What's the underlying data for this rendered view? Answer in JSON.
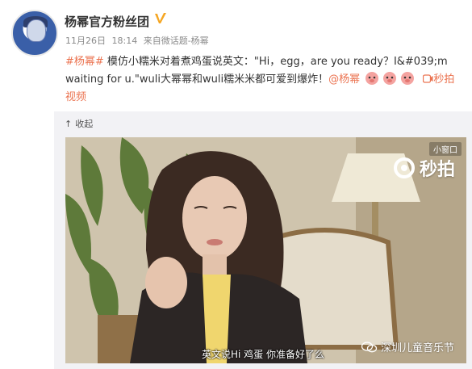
{
  "post": {
    "username": "杨幂官方粉丝团",
    "verified_icon": "verified-v-icon",
    "date": "11月26日",
    "time": "18:14",
    "source_prefix": "来自",
    "source": "微话题-杨幂",
    "hashtag": "#杨幂#",
    "text_line1": " 模仿小糯米对着煮鸡蛋说英文：\"Hi，egg，are you ready？I&#039;m",
    "text_line2_start": "waiting for u.\"wuli大幂幂和wuli糯米米都可爱到爆炸！",
    "mention": "@杨幂",
    "video_link_1": "秒拍",
    "video_link_2": "视频"
  },
  "media": {
    "collapse_label": "收起",
    "small_window_label": "小窗口",
    "player_brand": "秒拍",
    "subtitle": "英文说Hi 鸡蛋 你准备好了么",
    "watermark": "深圳儿童音乐节"
  },
  "colors": {
    "link": "#eb7350",
    "verified": "#f5a623",
    "text": "#333333",
    "meta": "#8a8a8a"
  }
}
